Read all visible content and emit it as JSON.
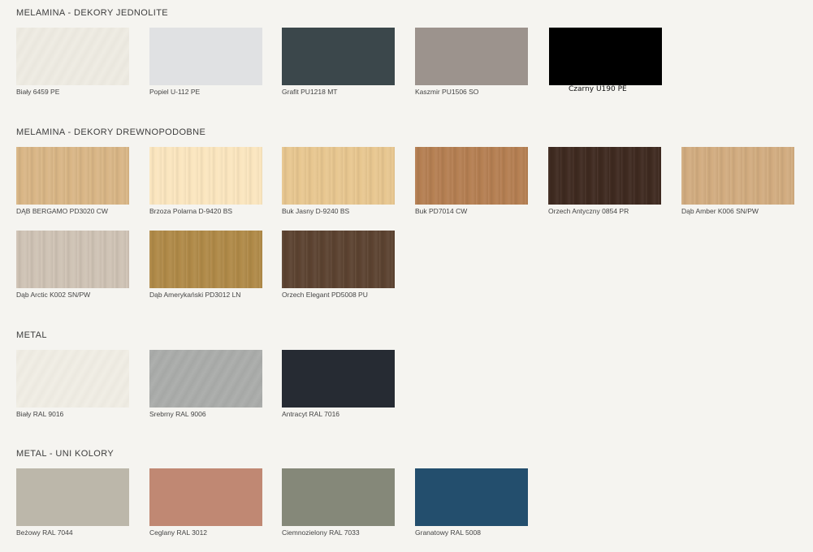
{
  "sections": [
    {
      "title": "MELAMINA - DEKORY JEDNOLITE"
    },
    {
      "title": "MELAMINA - DEKORY DREWNOPODOBNE"
    },
    {
      "title": "METAL"
    },
    {
      "title": "METAL - UNI KOLORY"
    }
  ],
  "swatches": [
    {
      "name": "Biały 6459 PE",
      "color": "#eeebe2"
    },
    {
      "name": "Popiel U-112 PE",
      "color": "#e0e1e3"
    },
    {
      "name": "Grafit PU1218 MT",
      "color": "#3b474b"
    },
    {
      "name": "Kaszmir PU1506 SO",
      "color": "#9c938d"
    },
    {
      "name": "Czarny U190 PE",
      "color": "#000000"
    },
    {
      "name": "DĄB BERGAMO PD3020 CW",
      "color": "#d9b686"
    },
    {
      "name": "Brzoza Polarna D-9420 BS",
      "color": "#fbe6bf"
    },
    {
      "name": "Buk Jasny D-9240 BS",
      "color": "#e8c790"
    },
    {
      "name": "Buk PD7014 CW",
      "color": "#b57f52"
    },
    {
      "name": "Orzech Antyczny 0854 PR",
      "color": "#3f2a20"
    },
    {
      "name": "Dąb Amber K006 SN/PW",
      "color": "#d2ac80"
    },
    {
      "name": "Dąb Arctic K002 SN/PW",
      "color": "#cfc3b5"
    },
    {
      "name": "Dąb Amerykański PD3012 LN",
      "color": "#b08a48"
    },
    {
      "name": "Orzech Elegant PD5008 PU",
      "color": "#5c4331"
    },
    {
      "name": "Biały RAL 9016",
      "color": "#f0ede4"
    },
    {
      "name": "Srebrny RAL 9006",
      "color": "#a9aba9"
    },
    {
      "name": "Antracyt RAL 7016",
      "color": "#262b33"
    },
    {
      "name": "Beżowy RAL 7044",
      "color": "#bcb7aa"
    },
    {
      "name": "Ceglany RAL 3012",
      "color": "#c08873"
    },
    {
      "name": "Ciemnozielony RAL 7033",
      "color": "#858879"
    },
    {
      "name": "Granatowy RAL 5008",
      "color": "#234e6d"
    }
  ]
}
